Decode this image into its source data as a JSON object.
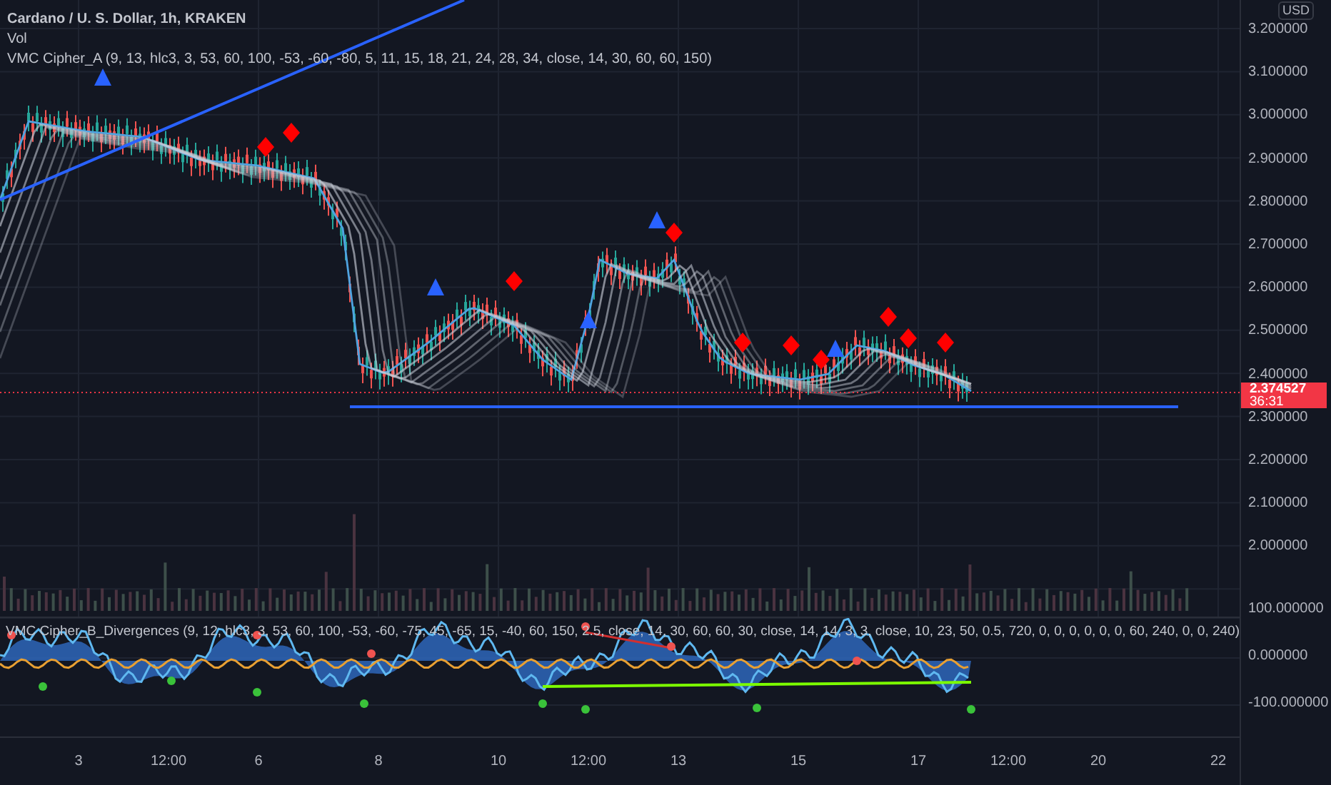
{
  "legend": {
    "symbol": "Cardano / U. S. Dollar, 1h, KRAKEN",
    "indicators": [
      "Vol",
      "VMC Cipher_A (9, 13, hlc3, 3, 53, 60, 100, -53, -60, -80, 5, 11, 15, 18, 21, 24, 28, 34, close, 14, 30, 60, 60, 150)"
    ]
  },
  "price_axis": {
    "currency": "USD",
    "ticks": [
      "3.200000",
      "3.100000",
      "3.000000",
      "2.900000",
      "2.800000",
      "2.700000",
      "2.600000",
      "2.500000",
      "2.400000",
      "2.300000",
      "2.200000",
      "2.100000",
      "2.000000"
    ],
    "last_price": "2.374527",
    "countdown": "36:31"
  },
  "oscillator": {
    "legend": "VMC Cipher_B_Divergences (9, 12, hlc3, 3, 53, 60, 100, -53, -60, -75, 45, -65, 15, -40, 60, 150, 2.5, close, 14, 30, 60, 60, 30, close, 14, 14, 3, 3, close, 10, 23, 50, 0.5, 720, 0, 0, 0, 0, 0, 0, 60, 240, 0, 0, 240)",
    "ticks": [
      "100.000000",
      "0.000000",
      "-100.000000"
    ]
  },
  "time_axis": {
    "ticks": [
      "3",
      "12:00",
      "6",
      "8",
      "10",
      "12:00",
      "13",
      "15",
      "17",
      "12:00",
      "20",
      "22"
    ]
  }
}
